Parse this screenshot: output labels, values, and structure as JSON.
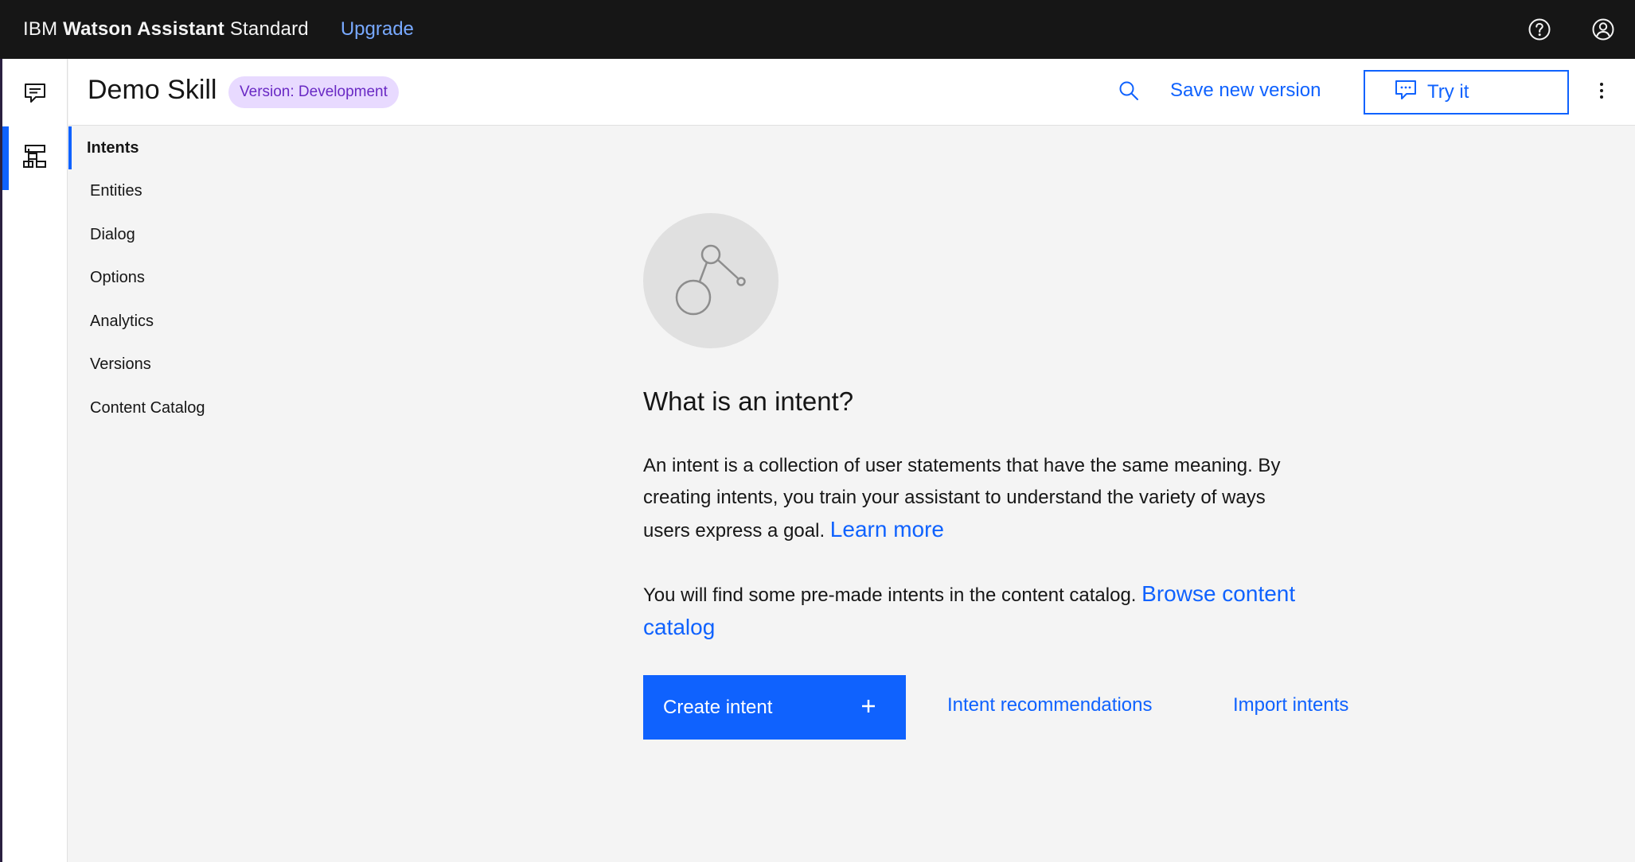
{
  "header": {
    "brand_prefix": "IBM",
    "brand_name": "Watson Assistant",
    "brand_plan": "Standard",
    "upgrade_label": "Upgrade",
    "help_icon": "help-icon",
    "user_icon": "user-avatar-icon"
  },
  "rail": {
    "items": [
      {
        "icon": "chat-icon",
        "active": false
      },
      {
        "icon": "skills-icon",
        "active": true
      }
    ]
  },
  "skill": {
    "title": "Demo Skill",
    "version_tag": "Version: Development",
    "save_version_label": "Save new version",
    "try_it_label": "Try it"
  },
  "subnav": {
    "items": [
      {
        "label": "Intents",
        "active": true
      },
      {
        "label": "Entities",
        "active": false
      },
      {
        "label": "Dialog",
        "active": false
      },
      {
        "label": "Options",
        "active": false
      },
      {
        "label": "Analytics",
        "active": false
      },
      {
        "label": "Versions",
        "active": false
      },
      {
        "label": "Content Catalog",
        "active": false
      }
    ]
  },
  "empty_state": {
    "title": "What is an intent?",
    "description": "An intent is a collection of user statements that have the same meaning. By creating intents, you train your assistant to understand the variety of ways users express a goal. ",
    "learn_more": "Learn more",
    "catalog_text": "You will find some pre-made intents in the content catalog. ",
    "browse_catalog": "Browse content catalog",
    "create_intent_label": "Create intent",
    "intent_recommendations_label": "Intent recommendations",
    "import_intents_label": "Import intents"
  },
  "colors": {
    "header_bg": "#161616",
    "accent": "#0f62fe",
    "tag_bg": "#e8daff",
    "tag_text": "#6929c4",
    "page_bg": "#f4f4f4"
  }
}
